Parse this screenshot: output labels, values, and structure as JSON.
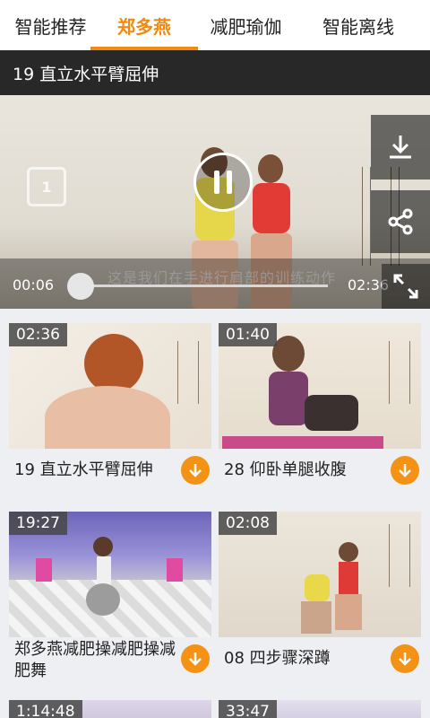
{
  "tabs": [
    {
      "label": "智能推荐",
      "active": false
    },
    {
      "label": "郑多燕",
      "active": true
    },
    {
      "label": "减肥瑜伽",
      "active": false
    },
    {
      "label": "智能离线",
      "active": false
    }
  ],
  "player": {
    "title": "19 直立水平臂屈伸",
    "subtitle": "这是我们在手进行肩部的训练动作",
    "current_time": "00:06",
    "total_time": "02:36",
    "progress": 0.04,
    "icons": {
      "rotate": "rotate-1-icon",
      "pause": "pause-icon",
      "download": "download-icon",
      "share": "share-icon",
      "fullscreen": "fullscreen-icon"
    }
  },
  "videos": [
    {
      "duration": "02:36",
      "title": "19 直立水平臂屈伸"
    },
    {
      "duration": "01:40",
      "title": "28 仰卧单腿收腹"
    },
    {
      "duration": "19:27",
      "title": "郑多燕减肥操减肥操减肥舞"
    },
    {
      "duration": "02:08",
      "title": "08 四步骤深蹲"
    },
    {
      "duration": "1:14:48",
      "title": ""
    },
    {
      "duration": "33:47",
      "title": ""
    }
  ],
  "colors": {
    "accent": "#f08a10",
    "download_button": "#f39215"
  }
}
